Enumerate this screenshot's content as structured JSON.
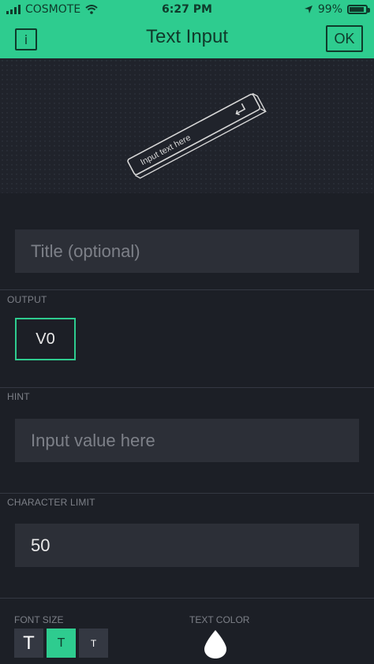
{
  "status_bar": {
    "carrier": "COSMOTE",
    "time": "6:27 PM",
    "battery": "99%",
    "icons": [
      "signal-icon",
      "wifi-icon",
      "location-arrow-icon",
      "battery-icon"
    ]
  },
  "header": {
    "title": "Text Input",
    "info_label": "i",
    "ok_label": "OK"
  },
  "preview": {
    "widget_text": "Input text here"
  },
  "title_field": {
    "placeholder": "Title (optional)"
  },
  "output": {
    "label": "OUTPUT",
    "pin": "V0"
  },
  "hint": {
    "label": "HINT",
    "placeholder": "Input value here"
  },
  "character_limit": {
    "label": "CHARACTER LIMIT",
    "value": "50"
  },
  "font_size": {
    "label": "FONT SIZE",
    "options": [
      "T",
      "T",
      "T"
    ],
    "selected_index": 1
  },
  "text_color": {
    "label": "TEXT COLOR",
    "icon": "drop-icon",
    "value": "#ffffff"
  },
  "colors": {
    "accent": "#2ecc8f",
    "background": "#1c1f26",
    "field": "#2c2f37"
  }
}
